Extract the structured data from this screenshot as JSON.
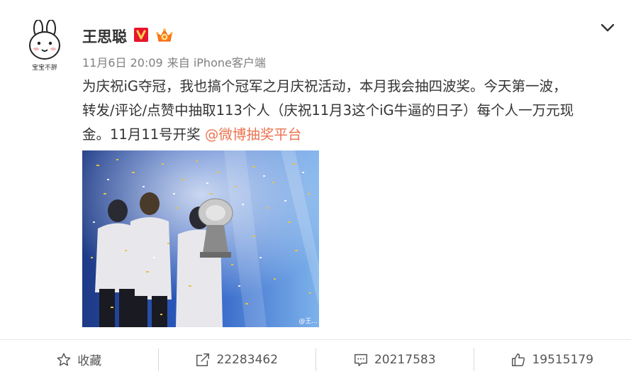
{
  "post": {
    "author": "王思聪",
    "avatar_caption": "宝宝不胖",
    "date": "11月6日 20:09",
    "source": "来自 iPhone客户端",
    "text_line1": "为庆祝iG夺冠，我也搞个冠军之月庆祝活动，本月我会抽四波奖。今天第一波，",
    "text_line2": "转发/评论/点赞中抽取113个人（庆祝11月3这个iG牛逼的日子）每个人一万元现",
    "text_line3_prefix": "金。11月11号开奖 ",
    "mention": "@微博抽奖平台",
    "image_watermark": "@王..."
  },
  "actions": {
    "favorite_label": "收藏",
    "repost_count": "22283462",
    "comment_count": "20217583",
    "like_count": "19515179"
  },
  "colors": {
    "mention": "#eb7350",
    "verified": "#e6162d",
    "text": "#333333",
    "meta": "#808080"
  },
  "icons": {
    "verified": "verified-v-icon",
    "crown": "vip-crown-icon",
    "menu": "chevron-down-icon",
    "favorite": "star-icon",
    "repost": "repost-icon",
    "comment": "comment-icon",
    "like": "thumbs-up-icon"
  }
}
